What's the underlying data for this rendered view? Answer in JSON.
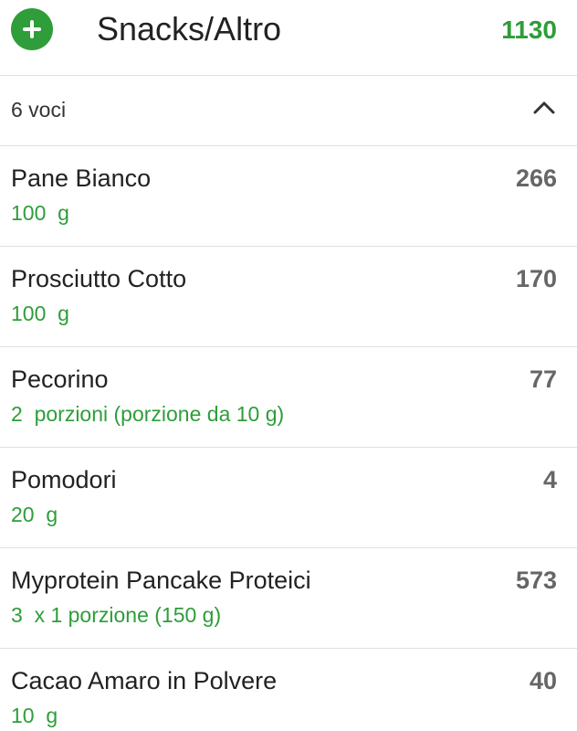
{
  "meal": {
    "title": "Snacks/Altro",
    "total_calories": "1130",
    "add_icon": "plus-circle-icon"
  },
  "summary": {
    "entries_label": "6 voci",
    "collapse_icon": "chevron-up-icon"
  },
  "colors": {
    "accent_green": "#2e9d3a",
    "text_primary": "#222222",
    "calories_gray": "#666666",
    "divider": "#e0e0e0"
  },
  "foods": [
    {
      "name": "Pane Bianco",
      "quantity": "100  g",
      "calories": "266"
    },
    {
      "name": "Prosciutto Cotto",
      "quantity": "100  g",
      "calories": "170"
    },
    {
      "name": "Pecorino",
      "quantity": "2  porzioni (porzione da 10 g)",
      "calories": "77"
    },
    {
      "name": "Pomodori",
      "quantity": "20  g",
      "calories": "4"
    },
    {
      "name": "Myprotein Pancake Proteici",
      "quantity": "3  x 1 porzione (150 g)",
      "calories": "573"
    },
    {
      "name": "Cacao Amaro in Polvere",
      "quantity": "10  g",
      "calories": "40"
    }
  ]
}
